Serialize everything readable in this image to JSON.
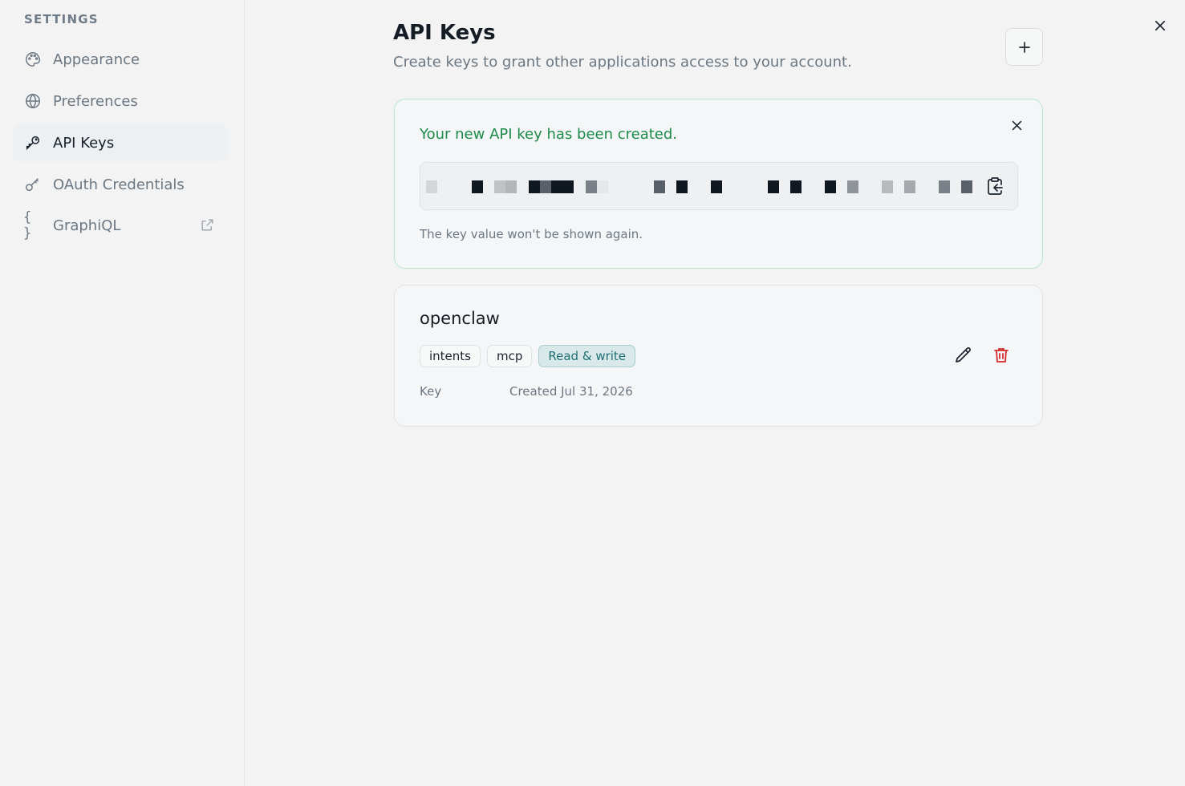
{
  "sidebar": {
    "heading": "SETTINGS",
    "items": [
      {
        "label": "Appearance",
        "icon": "palette-icon"
      },
      {
        "label": "Preferences",
        "icon": "globe-icon"
      },
      {
        "label": "API Keys",
        "icon": "key-icon",
        "active": true
      },
      {
        "label": "OAuth Credentials",
        "icon": "oauth-key-icon"
      },
      {
        "label": "GraphiQL",
        "icon": "braces-icon",
        "icon_text": "{ }",
        "external": true
      }
    ]
  },
  "header": {
    "title": "API Keys",
    "subtitle": "Create keys to grant other applications access to your account.",
    "add_icon": "plus-icon"
  },
  "created_notice": {
    "title": "Your new API key has been created.",
    "note": "The key value won't be shown again.",
    "key_value_redacted": true,
    "copy_icon": "clipboard-copy-icon"
  },
  "api_keys": [
    {
      "name": "openclaw",
      "tags": [
        "intents",
        "mcp"
      ],
      "permission": "Read & write",
      "key_label": "Key",
      "created": "Created Jul 31, 2026"
    }
  ],
  "colors": {
    "success": "#1c8a49",
    "danger": "#d42a2a",
    "permission_badge": "#d9e9ea",
    "active_nav": "#ecf0f3"
  }
}
